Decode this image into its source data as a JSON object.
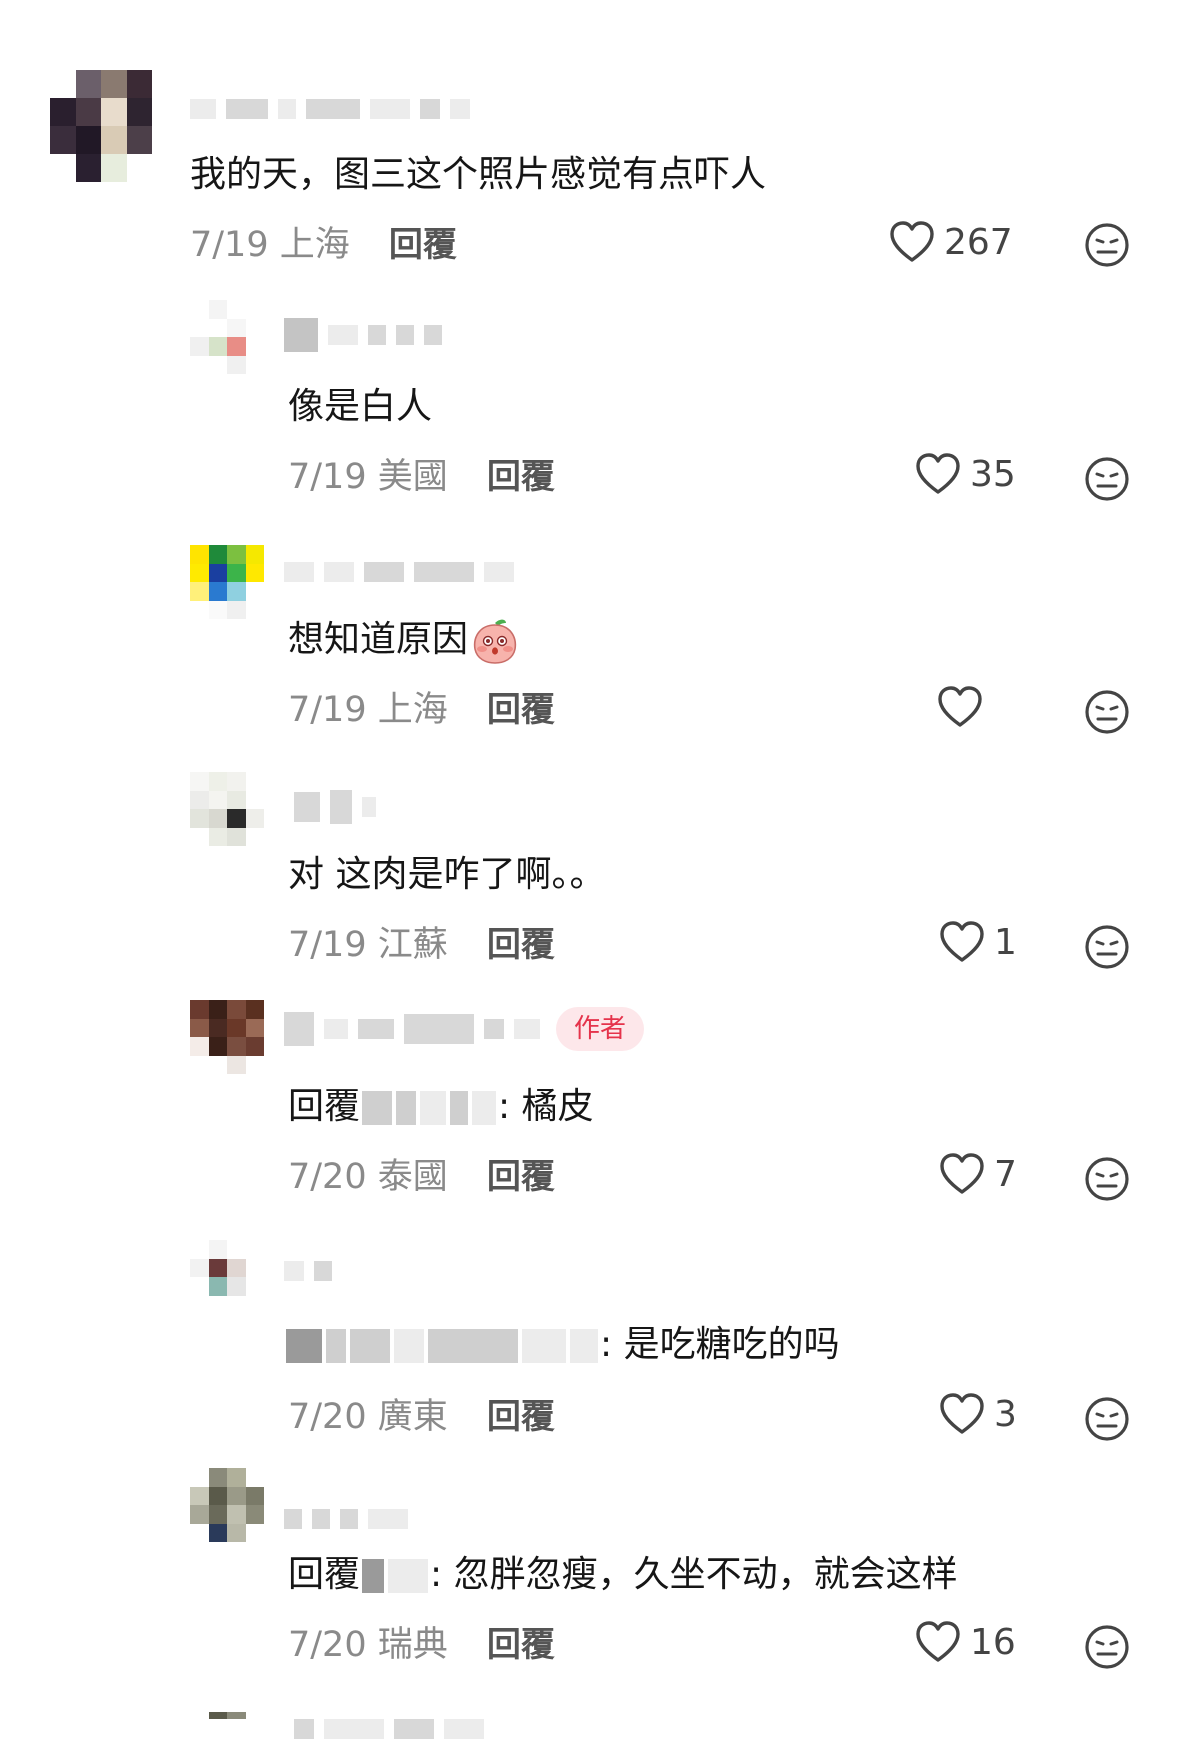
{
  "reply_label": "回覆",
  "author_badge": "作者",
  "comments": [
    {
      "text": "我的天，图三这个照片感觉有点吓人",
      "date": "7/19",
      "location": "上海",
      "likes": "267"
    },
    {
      "text": "像是白人",
      "date": "7/19",
      "location": "美國",
      "likes": "35"
    },
    {
      "text": "想知道原因",
      "date": "7/19",
      "location": "上海",
      "likes": "",
      "emoji": "peach-face-emoji"
    },
    {
      "text": "对 这肉是咋了啊。。",
      "date": "7/19",
      "location": "江蘇",
      "likes": "1"
    },
    {
      "text_prefix": "回覆",
      "text": ": 橘皮",
      "date": "7/20",
      "location": "泰國",
      "likes": "7",
      "is_author": true
    },
    {
      "text": ": 是吃糖吃的吗",
      "date": "7/20",
      "location": "廣東",
      "likes": "3"
    },
    {
      "text_prefix": "回覆",
      "text": ": 忽胖忽瘦，久坐不动，就会这样",
      "date": "7/20",
      "location": "瑞典",
      "likes": "16"
    }
  ],
  "icons": {
    "like": "heart-outline-icon",
    "dislike": "neutral-face-icon"
  },
  "colors": {
    "badge_bg": "#fde7ea",
    "badge_text": "#e5334b",
    "meta": "#8a8a8a",
    "text": "#161616"
  }
}
